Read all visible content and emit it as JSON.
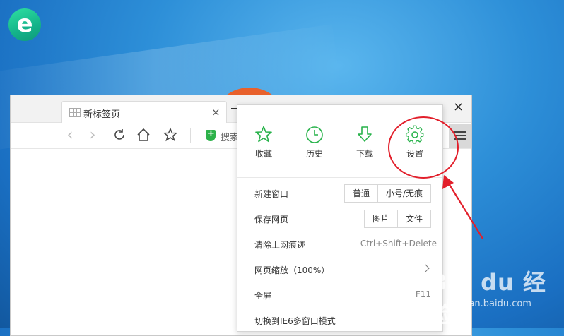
{
  "tab": {
    "title": "新标签页",
    "close": "×"
  },
  "window": {
    "close": "×"
  },
  "toolbar": {
    "back": "‹",
    "forward": "›",
    "refresh": "↻",
    "search_text": "搜索"
  },
  "menu": {
    "quick_actions": [
      {
        "label": "收藏",
        "icon": "star-icon"
      },
      {
        "label": "历史",
        "icon": "clock-icon"
      },
      {
        "label": "下载",
        "icon": "download-icon"
      },
      {
        "label": "设置",
        "icon": "gear-icon"
      }
    ],
    "new_window": {
      "label": "新建窗口",
      "normal": "普通",
      "small": "小号/无痕"
    },
    "save_page": {
      "label": "保存网页",
      "image": "图片",
      "file": "文件"
    },
    "clear_history": {
      "label": "清除上网痕迹",
      "shortcut": "Ctrl+Shift+Delete"
    },
    "zoom": {
      "label": "网页缩放（100%）"
    },
    "fullscreen": {
      "label": "全屏",
      "shortcut": "F11"
    },
    "ie6_mode": {
      "label": "切换到IE6多窗口模式"
    }
  },
  "watermark": {
    "brand": "Bai du 经验",
    "url": "jingyan.baidu.com"
  },
  "colors": {
    "accent_green": "#27b24a",
    "annotation_red": "#e21f2b"
  }
}
